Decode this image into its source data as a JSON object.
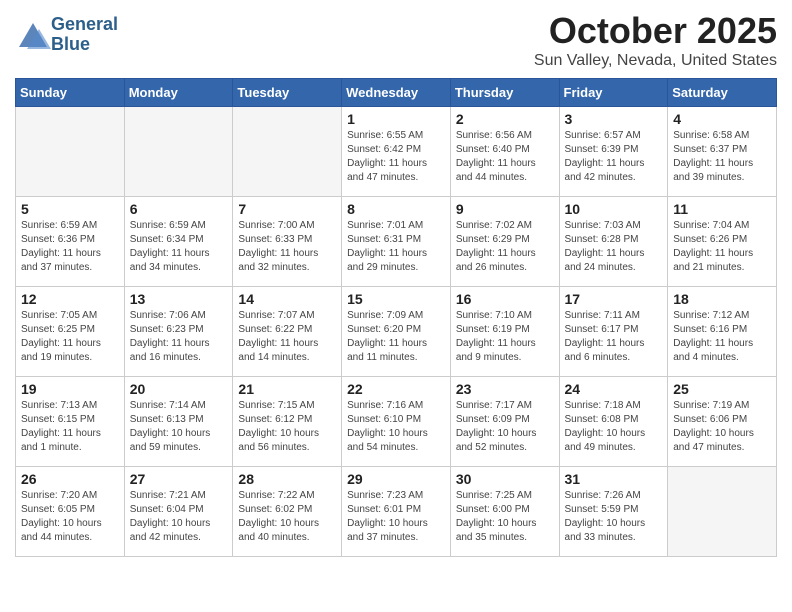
{
  "header": {
    "logo_line1": "General",
    "logo_line2": "Blue",
    "month": "October 2025",
    "location": "Sun Valley, Nevada, United States"
  },
  "weekdays": [
    "Sunday",
    "Monday",
    "Tuesday",
    "Wednesday",
    "Thursday",
    "Friday",
    "Saturday"
  ],
  "weeks": [
    [
      {
        "day": "",
        "info": ""
      },
      {
        "day": "",
        "info": ""
      },
      {
        "day": "",
        "info": ""
      },
      {
        "day": "1",
        "info": "Sunrise: 6:55 AM\nSunset: 6:42 PM\nDaylight: 11 hours\nand 47 minutes."
      },
      {
        "day": "2",
        "info": "Sunrise: 6:56 AM\nSunset: 6:40 PM\nDaylight: 11 hours\nand 44 minutes."
      },
      {
        "day": "3",
        "info": "Sunrise: 6:57 AM\nSunset: 6:39 PM\nDaylight: 11 hours\nand 42 minutes."
      },
      {
        "day": "4",
        "info": "Sunrise: 6:58 AM\nSunset: 6:37 PM\nDaylight: 11 hours\nand 39 minutes."
      }
    ],
    [
      {
        "day": "5",
        "info": "Sunrise: 6:59 AM\nSunset: 6:36 PM\nDaylight: 11 hours\nand 37 minutes."
      },
      {
        "day": "6",
        "info": "Sunrise: 6:59 AM\nSunset: 6:34 PM\nDaylight: 11 hours\nand 34 minutes."
      },
      {
        "day": "7",
        "info": "Sunrise: 7:00 AM\nSunset: 6:33 PM\nDaylight: 11 hours\nand 32 minutes."
      },
      {
        "day": "8",
        "info": "Sunrise: 7:01 AM\nSunset: 6:31 PM\nDaylight: 11 hours\nand 29 minutes."
      },
      {
        "day": "9",
        "info": "Sunrise: 7:02 AM\nSunset: 6:29 PM\nDaylight: 11 hours\nand 26 minutes."
      },
      {
        "day": "10",
        "info": "Sunrise: 7:03 AM\nSunset: 6:28 PM\nDaylight: 11 hours\nand 24 minutes."
      },
      {
        "day": "11",
        "info": "Sunrise: 7:04 AM\nSunset: 6:26 PM\nDaylight: 11 hours\nand 21 minutes."
      }
    ],
    [
      {
        "day": "12",
        "info": "Sunrise: 7:05 AM\nSunset: 6:25 PM\nDaylight: 11 hours\nand 19 minutes."
      },
      {
        "day": "13",
        "info": "Sunrise: 7:06 AM\nSunset: 6:23 PM\nDaylight: 11 hours\nand 16 minutes."
      },
      {
        "day": "14",
        "info": "Sunrise: 7:07 AM\nSunset: 6:22 PM\nDaylight: 11 hours\nand 14 minutes."
      },
      {
        "day": "15",
        "info": "Sunrise: 7:09 AM\nSunset: 6:20 PM\nDaylight: 11 hours\nand 11 minutes."
      },
      {
        "day": "16",
        "info": "Sunrise: 7:10 AM\nSunset: 6:19 PM\nDaylight: 11 hours\nand 9 minutes."
      },
      {
        "day": "17",
        "info": "Sunrise: 7:11 AM\nSunset: 6:17 PM\nDaylight: 11 hours\nand 6 minutes."
      },
      {
        "day": "18",
        "info": "Sunrise: 7:12 AM\nSunset: 6:16 PM\nDaylight: 11 hours\nand 4 minutes."
      }
    ],
    [
      {
        "day": "19",
        "info": "Sunrise: 7:13 AM\nSunset: 6:15 PM\nDaylight: 11 hours\nand 1 minute."
      },
      {
        "day": "20",
        "info": "Sunrise: 7:14 AM\nSunset: 6:13 PM\nDaylight: 10 hours\nand 59 minutes."
      },
      {
        "day": "21",
        "info": "Sunrise: 7:15 AM\nSunset: 6:12 PM\nDaylight: 10 hours\nand 56 minutes."
      },
      {
        "day": "22",
        "info": "Sunrise: 7:16 AM\nSunset: 6:10 PM\nDaylight: 10 hours\nand 54 minutes."
      },
      {
        "day": "23",
        "info": "Sunrise: 7:17 AM\nSunset: 6:09 PM\nDaylight: 10 hours\nand 52 minutes."
      },
      {
        "day": "24",
        "info": "Sunrise: 7:18 AM\nSunset: 6:08 PM\nDaylight: 10 hours\nand 49 minutes."
      },
      {
        "day": "25",
        "info": "Sunrise: 7:19 AM\nSunset: 6:06 PM\nDaylight: 10 hours\nand 47 minutes."
      }
    ],
    [
      {
        "day": "26",
        "info": "Sunrise: 7:20 AM\nSunset: 6:05 PM\nDaylight: 10 hours\nand 44 minutes."
      },
      {
        "day": "27",
        "info": "Sunrise: 7:21 AM\nSunset: 6:04 PM\nDaylight: 10 hours\nand 42 minutes."
      },
      {
        "day": "28",
        "info": "Sunrise: 7:22 AM\nSunset: 6:02 PM\nDaylight: 10 hours\nand 40 minutes."
      },
      {
        "day": "29",
        "info": "Sunrise: 7:23 AM\nSunset: 6:01 PM\nDaylight: 10 hours\nand 37 minutes."
      },
      {
        "day": "30",
        "info": "Sunrise: 7:25 AM\nSunset: 6:00 PM\nDaylight: 10 hours\nand 35 minutes."
      },
      {
        "day": "31",
        "info": "Sunrise: 7:26 AM\nSunset: 5:59 PM\nDaylight: 10 hours\nand 33 minutes."
      },
      {
        "day": "",
        "info": ""
      }
    ]
  ]
}
